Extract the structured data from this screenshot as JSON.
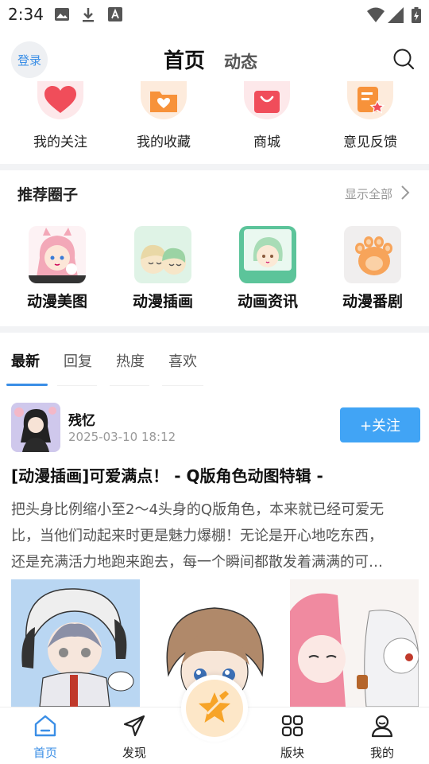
{
  "status": {
    "time": "2:34"
  },
  "topbar": {
    "login": "登录",
    "tab_home": "首页",
    "tab_feed": "动态"
  },
  "quick": [
    {
      "label": "我的关注",
      "icon": "heart-icon",
      "color": "#f04d5a"
    },
    {
      "label": "我的收藏",
      "icon": "favorite-folder-icon",
      "color": "#f7923a"
    },
    {
      "label": "商城",
      "icon": "shopping-bag-icon",
      "color": "#f04d5a"
    },
    {
      "label": "意见反馈",
      "icon": "feedback-icon",
      "color": "#f7923a"
    }
  ],
  "circles": {
    "title": "推荐圈子",
    "show_all": "显示全部",
    "items": [
      {
        "label": "动漫美图"
      },
      {
        "label": "动漫插画",
        "badge": "动漫插画"
      },
      {
        "label": "动画资讯",
        "badge": "动画资讯"
      },
      {
        "label": "动漫番剧"
      }
    ]
  },
  "feed_tabs": [
    "最新",
    "回复",
    "热度",
    "喜欢"
  ],
  "post": {
    "author": "残忆",
    "time": "2025-03-10 18:12",
    "follow": "+关注",
    "title": "[动漫插画]可爱满点！ - Q版角色动图特辑 -",
    "body_lines": [
      "把头身比例缩小至2～4头身的Q版角色，本来就已经可爱无",
      "比，当他们动起来时更是魅力爆棚！无论是开心地吃东西，",
      "还是充满活力地跑来跑去，每一个瞬间都散发着满满的可…"
    ]
  },
  "nav": [
    {
      "label": "首页",
      "icon": "home-icon"
    },
    {
      "label": "发现",
      "icon": "send-icon"
    },
    {
      "label": "版块",
      "icon": "grid-icon"
    },
    {
      "label": "我的",
      "icon": "user-icon"
    }
  ],
  "colors": {
    "accent": "#3a8ee6",
    "follow": "#41a4f5"
  }
}
